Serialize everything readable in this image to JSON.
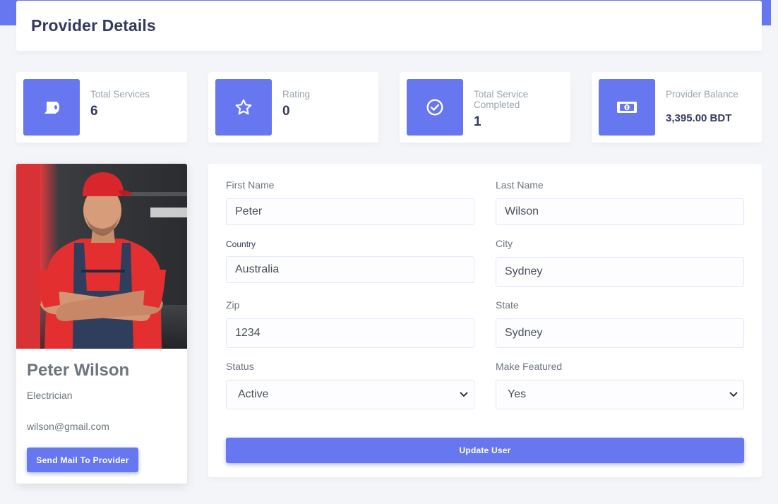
{
  "page": {
    "title": "Provider Details"
  },
  "stats": [
    {
      "label": "Total Services",
      "value": "6",
      "icon": "toilet-paper-icon"
    },
    {
      "label": "Rating",
      "value": "0",
      "icon": "star-icon"
    },
    {
      "label": "Total Service Completed",
      "value": "1",
      "icon": "check-circle-icon"
    },
    {
      "label": "Provider Balance",
      "value": "3,395.00 BDT",
      "icon": "money-bill-icon"
    }
  ],
  "profile": {
    "name": "Peter Wilson",
    "role": "Electrician",
    "email": "wilson@gmail.com",
    "mail_button": "Send Mail To Provider"
  },
  "form": {
    "first_name": {
      "label": "First Name",
      "value": "Peter"
    },
    "last_name": {
      "label": "Last Name",
      "value": "Wilson"
    },
    "country": {
      "label": "Country",
      "value": "Australia"
    },
    "city": {
      "label": "City",
      "value": "Sydney"
    },
    "zip": {
      "label": "Zip",
      "value": "1234"
    },
    "state": {
      "label": "State",
      "value": "Sydney"
    },
    "status": {
      "label": "Status",
      "value": "Active"
    },
    "featured": {
      "label": "Make Featured",
      "value": "Yes"
    },
    "submit": "Update User"
  },
  "colors": {
    "primary": "#6777ef",
    "background": "#f4f5f9",
    "heading": "#34395e",
    "muted": "#6c757d"
  }
}
